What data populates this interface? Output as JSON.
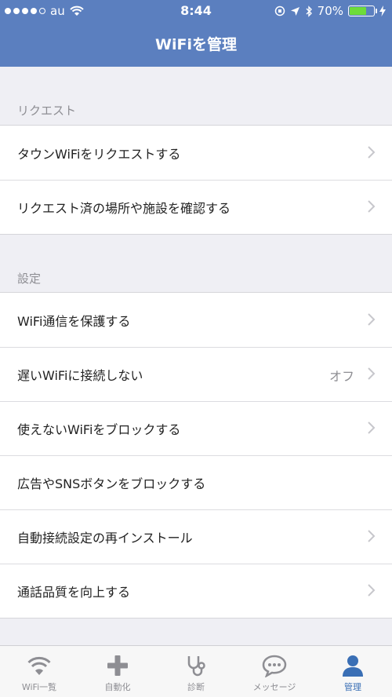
{
  "status": {
    "carrier": "au",
    "time": "8:44",
    "battery": "70%",
    "battery_level": 0.7
  },
  "header": {
    "title": "WiFiを管理"
  },
  "sections": [
    {
      "header": "リクエスト",
      "rows": [
        {
          "label": "タウンWiFiをリクエストする"
        },
        {
          "label": "リクエスト済の場所や施設を確認する"
        }
      ]
    },
    {
      "header": "設定",
      "rows": [
        {
          "label": "WiFi通信を保護する"
        },
        {
          "label": "遅いWiFiに接続しない",
          "value": "オフ"
        },
        {
          "label": "使えないWiFiをブロックする"
        },
        {
          "label": "広告やSNSボタンをブロックする"
        },
        {
          "label": "自動接続設定の再インストール"
        },
        {
          "label": "通話品質を向上する"
        }
      ]
    }
  ],
  "tabs": [
    {
      "label": "WiFi一覧",
      "icon": "wifi-icon"
    },
    {
      "label": "自動化",
      "icon": "plus-icon"
    },
    {
      "label": "診断",
      "icon": "stethoscope-icon"
    },
    {
      "label": "メッセージ",
      "icon": "chat-bubble-icon"
    },
    {
      "label": "管理",
      "icon": "person-icon",
      "active": true
    }
  ],
  "colors": {
    "header": "#5b7fbf",
    "active_tab": "#3a6fb5",
    "inactive_tab": "#8e8e93"
  }
}
